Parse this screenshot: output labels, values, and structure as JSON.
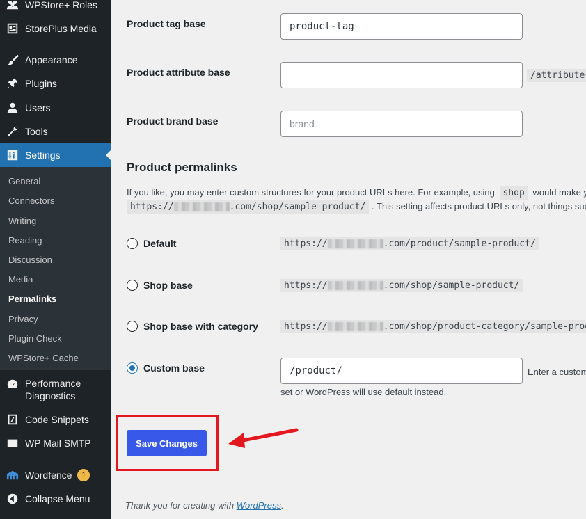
{
  "sidebar": {
    "items": [
      {
        "label": "WPStore+ Roles",
        "icon": "roles-icon"
      },
      {
        "label": "StorePlus Media",
        "icon": "media-grid-icon"
      },
      {
        "label": "Appearance",
        "icon": "appearance-brush-icon"
      },
      {
        "label": "Plugins",
        "icon": "plugins-icon"
      },
      {
        "label": "Users",
        "icon": "users-icon"
      },
      {
        "label": "Tools",
        "icon": "tools-wrench-icon"
      },
      {
        "label": "Settings",
        "icon": "settings-sliders-icon"
      }
    ],
    "submenu": [
      {
        "label": "General"
      },
      {
        "label": "Connectors"
      },
      {
        "label": "Writing"
      },
      {
        "label": "Reading"
      },
      {
        "label": "Discussion"
      },
      {
        "label": "Media"
      },
      {
        "label": "Permalinks"
      },
      {
        "label": "Privacy"
      },
      {
        "label": "Plugin Check"
      },
      {
        "label": "WPStore+ Cache"
      }
    ],
    "lower_items": [
      {
        "label_line1": "Performance",
        "label_line2": "Diagnostics",
        "icon": "performance-gauge-icon"
      },
      {
        "label": "Code Snippets",
        "icon": "code-snippets-icon"
      },
      {
        "label": "WP Mail SMTP",
        "icon": "mail-icon"
      },
      {
        "label": "Wordfence",
        "icon": "wordfence-icon",
        "badge": "1"
      },
      {
        "label": "Collapse Menu",
        "icon": "collapse-icon"
      }
    ],
    "accent_color": "#2271b1"
  },
  "fields": {
    "tag_base": {
      "label": "Product tag base",
      "value": "product-tag"
    },
    "attribute_base": {
      "label": "Product attribute base",
      "value": "",
      "suffix": "/attribute-n"
    },
    "brand_base": {
      "label": "Product brand base",
      "placeholder": "brand"
    }
  },
  "permalinks": {
    "heading": "Product permalinks",
    "desc_line1_pre": "If you like, you may enter custom structures for your product URLs here. For example, using",
    "desc_line1_code": "shop",
    "desc_line1_post": "would make yo",
    "desc_line2_code_pre": "https://",
    "desc_line2_code_post": ".com/shop/sample-product/",
    "desc_line2_post": ". This setting affects product URLs only, not things such a",
    "options": [
      {
        "label": "Default",
        "url_pre": "https://",
        "url_post": ".com/product/sample-product/",
        "checked": false
      },
      {
        "label": "Shop base",
        "url_pre": "https://",
        "url_post": ".com/shop/sample-product/",
        "checked": false
      },
      {
        "label": "Shop base with category",
        "url_pre": "https://",
        "url_post": ".com/shop/product-category/sample-product",
        "checked": false
      },
      {
        "label": "Custom base",
        "value": "/product/",
        "hint": "Enter a custom",
        "hint2": "set or WordPress will use default instead.",
        "checked": true
      }
    ]
  },
  "save_label": "Save Changes",
  "footer": {
    "text": "Thank you for creating with",
    "link": "WordPress",
    "end": "."
  },
  "annotation": {
    "highlight_color": "#e3171d"
  }
}
